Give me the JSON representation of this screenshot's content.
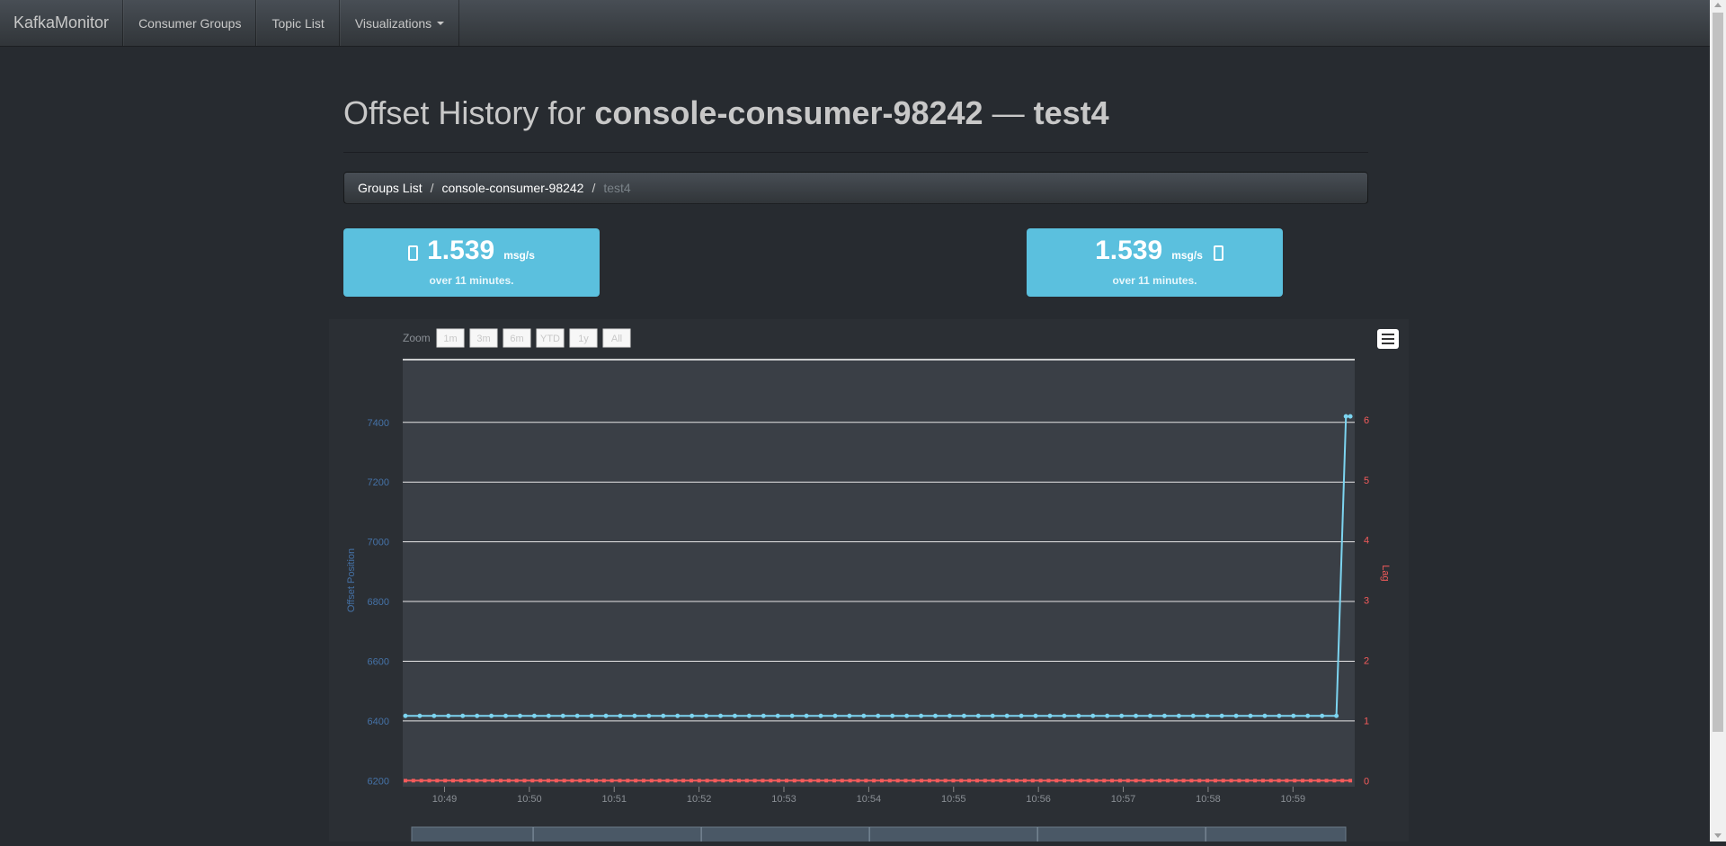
{
  "navbar": {
    "brand": "KafkaMonitor",
    "items": [
      "Consumer Groups",
      "Topic List",
      "Visualizations"
    ]
  },
  "page": {
    "title_prefix": "Offset History for ",
    "group": "console-consumer-98242",
    "separator": " — ",
    "topic": "test4"
  },
  "breadcrumb": {
    "items": [
      "Groups List",
      "console-consumer-98242"
    ],
    "active": "test4",
    "separator": "/"
  },
  "rates": [
    {
      "value": "1.539",
      "unit": "msg/s",
      "note": "over 11 minutes.",
      "icon": "arrow-in-icon"
    },
    {
      "value": "1.539",
      "unit": "msg/s",
      "note": "over 11 minutes.",
      "icon": "arrow-out-icon"
    }
  ],
  "colors": {
    "accent": "#5bc0de",
    "offset_series": "#7cd4f0",
    "lag_series": "#f45b5b",
    "left_axis": "#4572a7",
    "right_axis": "#f45b5b"
  },
  "chart_data": {
    "type": "line",
    "zoom": {
      "label": "Zoom",
      "buttons": [
        "1m",
        "3m",
        "6m",
        "YTD",
        "1y",
        "All"
      ]
    },
    "x_ticks": [
      "10:49",
      "10:50",
      "10:51",
      "10:52",
      "10:53",
      "10:54",
      "10:55",
      "10:56",
      "10:57",
      "10:58",
      "10:59"
    ],
    "left_axis": {
      "label": "Offset Position",
      "ticks": [
        6200,
        6400,
        6600,
        6800,
        7000,
        7200,
        7400
      ],
      "ylim": [
        6180,
        7610
      ]
    },
    "right_axis": {
      "label": "Lag",
      "ticks": [
        0,
        1,
        2,
        3,
        4,
        5,
        6
      ],
      "ylim": [
        -0.1,
        7.0
      ]
    },
    "x_range_minutes": [
      10.48,
      11.5
    ],
    "series": [
      {
        "name": "Offset Position",
        "axis": "left",
        "points": {
          "t_start": 0,
          "t_end": 10.72,
          "count": 66,
          "value": 6417,
          "final": [
            [
              10.83,
              7420
            ],
            [
              10.88,
              7420
            ]
          ]
        }
      },
      {
        "name": "Lag",
        "axis": "right",
        "points": {
          "t_start": 0,
          "t_end": 10.88,
          "count": 120,
          "value": 0
        }
      }
    ]
  }
}
